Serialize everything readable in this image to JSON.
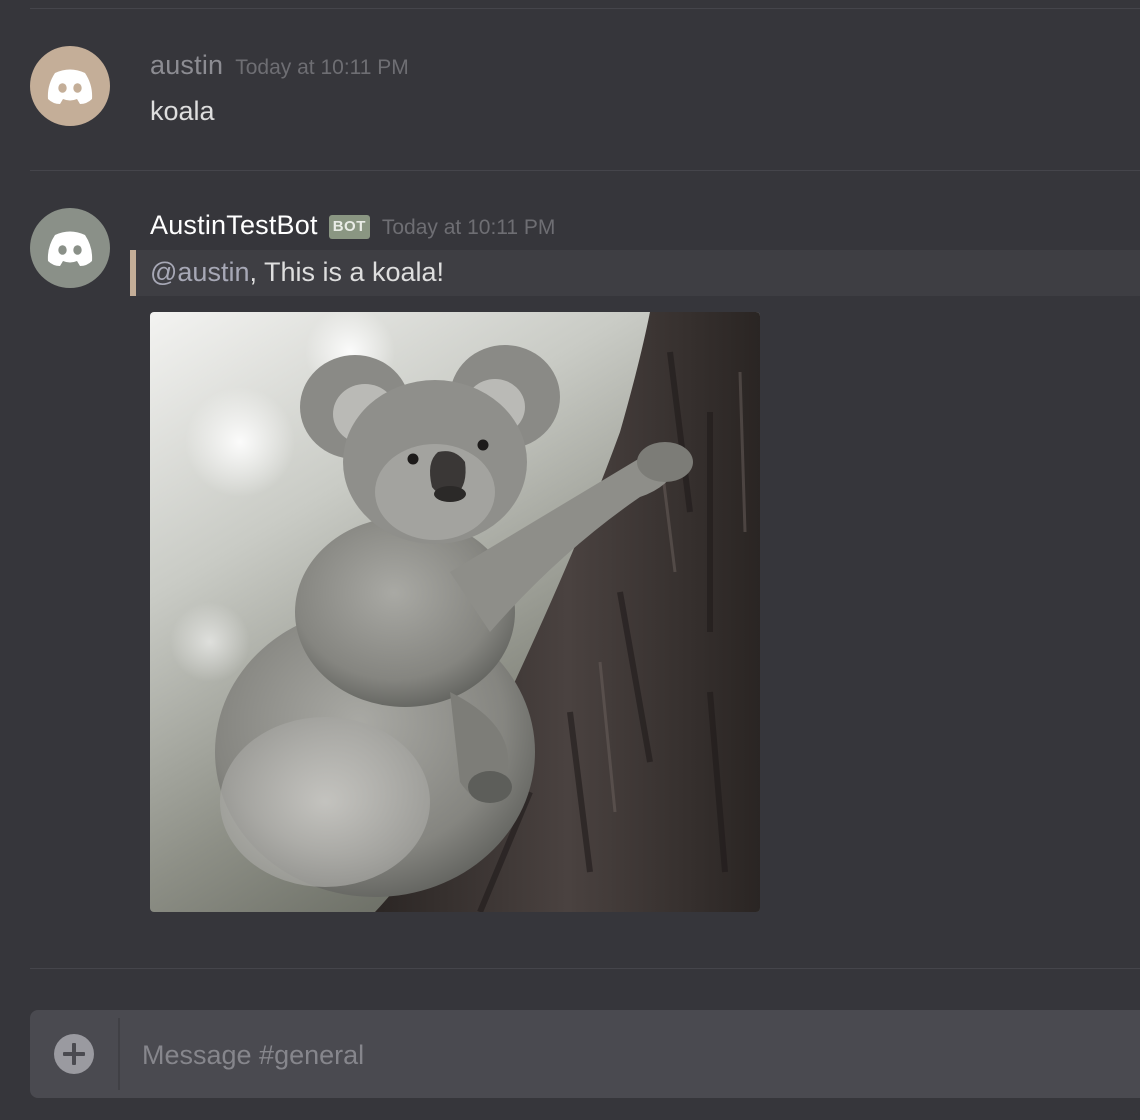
{
  "colors": {
    "background": "#36363b",
    "user_avatar_bg": "#c4ae98",
    "bot_avatar_bg": "#8a9088",
    "username_user": "#8c8c92",
    "username_bot": "#ffffff",
    "mention_bar": "#c4ae98",
    "bot_tag_bg": "#8a9682"
  },
  "messages": [
    {
      "author": "austin",
      "timestamp": "Today at 10:11 PM",
      "text": "koala",
      "avatar_icon": "discord-logo-icon"
    },
    {
      "author": "AustinTestBot",
      "badge": "BOT",
      "timestamp": "Today at 10:11 PM",
      "mention": "@austin",
      "text": ", This is a koala!",
      "avatar_icon": "discord-logo-icon",
      "attachment": {
        "type": "image",
        "subject": "koala-on-tree"
      }
    }
  ],
  "composer": {
    "placeholder": "Message #general",
    "upload_icon": "plus-circle-icon"
  }
}
